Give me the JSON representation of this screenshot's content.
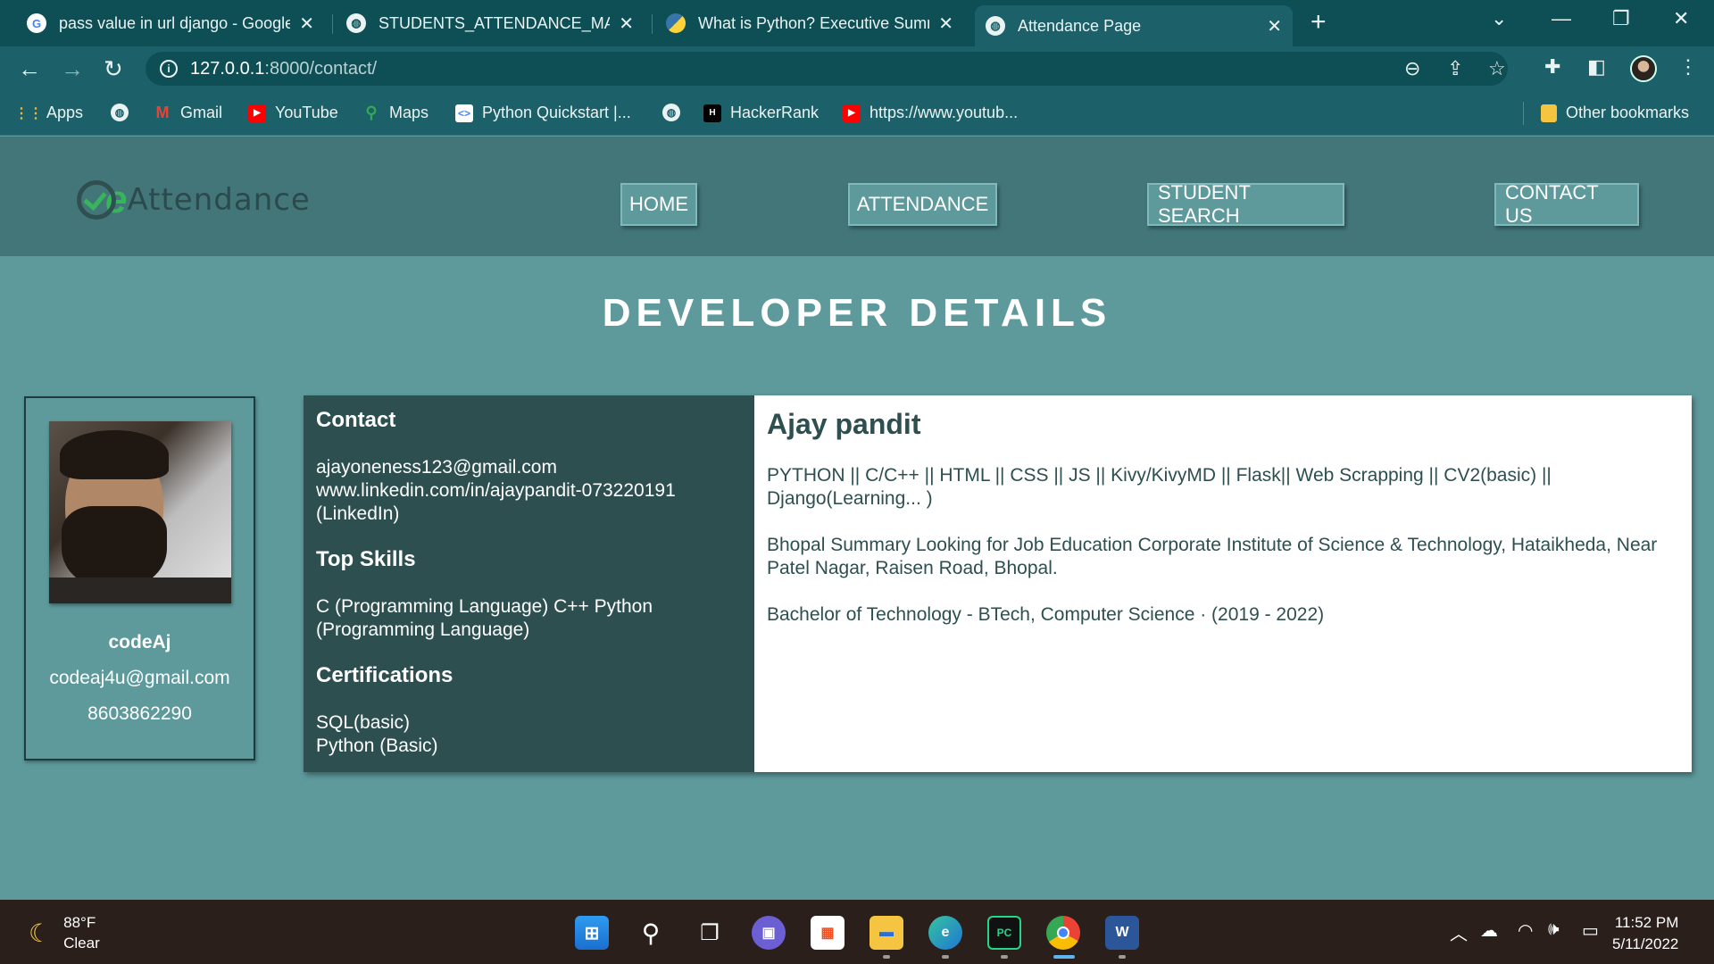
{
  "browser": {
    "tabs": [
      {
        "title": "pass value in url django - Google",
        "favicon": "google-icon"
      },
      {
        "title": "STUDENTS_ATTENDANCE_MANA",
        "favicon": "globe-icon"
      },
      {
        "title": "What is Python? Executive Summ",
        "favicon": "python-icon"
      },
      {
        "title": "Attendance Page",
        "favicon": "globe-icon",
        "active": true
      }
    ],
    "url_host": "127.0.0.1",
    "url_path": ":8000/contact/",
    "bookmarks": [
      {
        "label": "Apps",
        "icon": "apps-grid-icon"
      },
      {
        "label": "",
        "icon": "globe-icon"
      },
      {
        "label": "Gmail",
        "icon": "gmail-icon"
      },
      {
        "label": "YouTube",
        "icon": "youtube-icon"
      },
      {
        "label": "Maps",
        "icon": "maps-icon"
      },
      {
        "label": "Python Quickstart |...",
        "icon": "code-icon"
      },
      {
        "label": "",
        "icon": "globe-icon"
      },
      {
        "label": "HackerRank",
        "icon": "hackerrank-icon"
      },
      {
        "label": "https://www.youtub...",
        "icon": "youtube-icon"
      }
    ],
    "other_bookmarks": "Other bookmarks"
  },
  "site": {
    "logo_text": "Attendance",
    "logo_letter": "e",
    "nav": [
      "HOME",
      "ATTENDANCE",
      "STUDENT SEARCH",
      "CONTACT US"
    ],
    "page_title": "DEVELOPER DETAILS"
  },
  "profile_card": {
    "name": "codeAj",
    "email": "codeaj4u@gmail.com",
    "phone": "8603862290"
  },
  "details": {
    "contact_heading": "Contact",
    "contact_email": "ajayoneness123@gmail.com",
    "contact_linkedin": "www.linkedin.com/in/ajaypandit-073220191",
    "contact_linkedin_label": "(LinkedIn)",
    "skills_heading": "Top Skills",
    "skills_text": "C (Programming Language) C++ Python (Programming Language)",
    "cert_heading": "Certifications",
    "cert_1": "SQL(basic)",
    "cert_2": "Python (Basic)",
    "dev_name": "Ajay pandit",
    "tech_stack": "PYTHON || C/C++ || HTML || CSS || JS || Kivy/KivyMD || Flask|| Web Scrapping || CV2(basic) || Django(Learning... )",
    "summary": "Bhopal Summary Looking for Job Education Corporate Institute of Science & Technology, Hataikheda, Near Patel Nagar, Raisen Road, Bhopal.",
    "education": "Bachelor of Technology - BTech, Computer Science · (2019 - 2022)"
  },
  "taskbar": {
    "weather_temp": "88°F",
    "weather_cond": "Clear",
    "time": "11:52 PM",
    "date": "5/11/2022",
    "apps": [
      "start-icon",
      "search-icon",
      "task-view-icon",
      "chat-icon",
      "store-icon",
      "file-explorer-icon",
      "edge-icon",
      "pycharm-icon",
      "chrome-icon",
      "word-icon"
    ]
  },
  "colors": {
    "page_bg": "#5e9a9c",
    "header_bg": "#437679",
    "dark_panel": "#2e4f50",
    "browser_tabbar": "#0e4f56",
    "browser_toolbar": "#1c6169",
    "taskbar": "#2b1f1c",
    "logo_green": "#38b45c"
  }
}
